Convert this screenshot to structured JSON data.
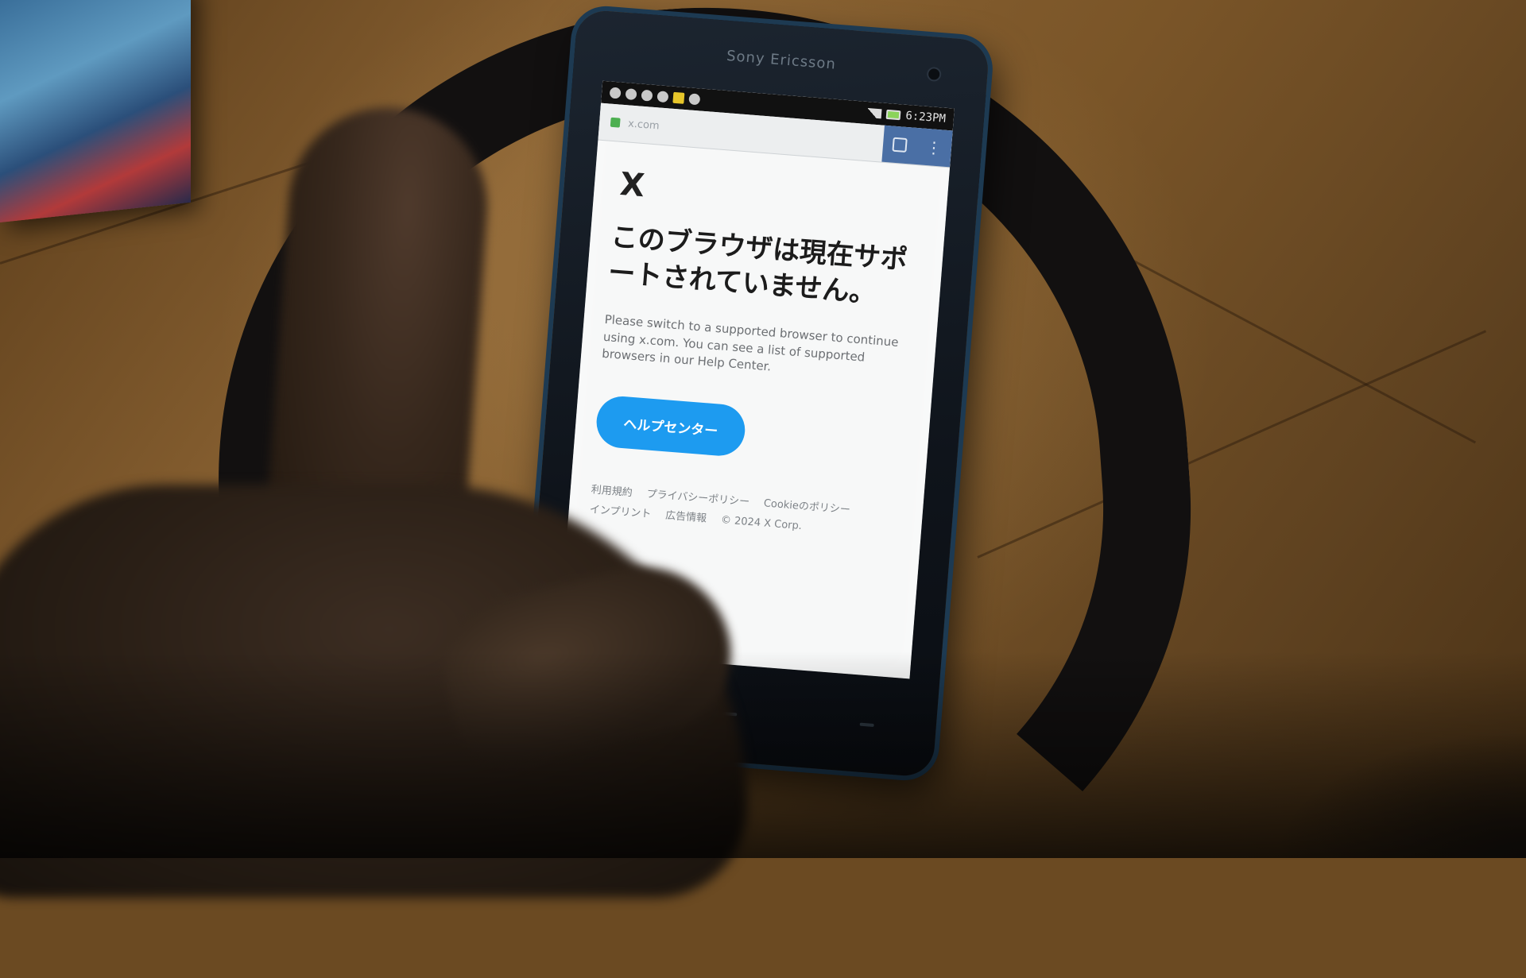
{
  "phone": {
    "brand": "Sony Ericsson",
    "status_time": "6:23PM"
  },
  "browser": {
    "url": "x.com"
  },
  "page": {
    "logo": "X",
    "headline": "このブラウザは現在サポートされていません。",
    "body": "Please switch to a supported browser to continue using x.com. You can see a list of supported browsers in our Help Center.",
    "button_label": "ヘルプセンター",
    "footer_links": [
      "利用規約",
      "プライバシーポリシー",
      "Cookieのポリシー",
      "インプリント",
      "広告情報",
      "© 2024 X Corp."
    ]
  },
  "colors": {
    "button": "#1d9bf0",
    "tab_area": "#4a6fa5"
  }
}
